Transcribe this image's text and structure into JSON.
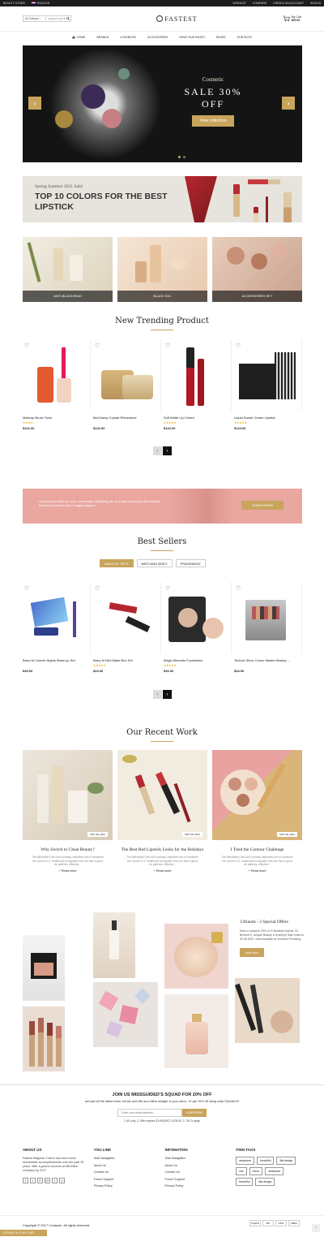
{
  "topbar": {
    "store": "BEAUTY STORE",
    "language": "ENGLISH",
    "wishlist": "WISHLIST",
    "compare": "COMPARE",
    "account": "CREATE AN ACCOUNT",
    "signin": "SIGN IN"
  },
  "header": {
    "category": "All Categor...",
    "search_placeholder": "SEARCH ENTIRE STO",
    "logo": "FASTEST",
    "cart_title": "My Cart",
    "cart_total": "$00.00",
    "cart_count": "0"
  },
  "nav": [
    "HOME",
    "BRANDS",
    "LOOKBOOK",
    "ACCESSORIES",
    "DEMO SUB PAGES",
    "PAGES",
    "OUR BLOG"
  ],
  "hero": {
    "subtitle": "Cosmetic",
    "title": "SALE 30% OFF",
    "cta": "View collection"
  },
  "lip_banner": {
    "line1": "Spring Summer 2021 Sale!",
    "line2": "TOP 10 COLORS FOR THE BEST LIPSTICK"
  },
  "categories": [
    "ANTI-BLACKHEAD",
    "BLACK SOL",
    "ACCESSORIES SET"
  ],
  "trending": {
    "title": "New Trending Product",
    "products": [
      {
        "name": "Makeup Brush Tools",
        "price": "$121.00",
        "stars": "★★★★☆"
      },
      {
        "name": "BioChamp Crystal Rhinestone",
        "price": "$122.00",
        "stars": ""
      },
      {
        "name": "Soft Matte Lip Cream",
        "price": "$122.00",
        "stars": "★★★★★"
      },
      {
        "name": "Liquid Suede Cream Lipstick",
        "price": "$124.00",
        "stars": "★★★★★"
      }
    ]
  },
  "promo": {
    "text": "Lorem ipsum dolor sit amet, consectetur adipiscing elit, sed diam nonummy nibh euismod tincidunt ut laoreet dolore magna aliquam",
    "cta": "LEARN MORE"
  },
  "bestsellers": {
    "title": "Best Sellers",
    "tabs": [
      "MAKE UP SETS",
      "BATH AND BODY",
      "FRAGRANCE"
    ],
    "products": [
      {
        "name": "Barry M Cosmic Nights Make-up Set",
        "price": "$45.00",
        "stars": ""
      },
      {
        "name": "Barry M Mini Matte Box Set",
        "price": "$23.00",
        "stars": "★★★★★"
      },
      {
        "name": "Magic Minerals Foundation",
        "price": "$26.00",
        "stars": "★★★★★"
      },
      {
        "name": "Technic Silver Colour Master Beauty ...",
        "price": "$34.00",
        "stars": ""
      }
    ]
  },
  "recent": {
    "title": "Our Recent Work",
    "posts": [
      {
        "title": "Why Switch to Clean Beauty?",
        "date": "MAY 08, 2021",
        "excerpt": "The Affordable Care Act's primary objectives are to transform the current U.S. healthcare ecosystem into one that is good for patients, effective...",
        "more": "+ Read more"
      },
      {
        "title": "The Best Red Lipstick Looks for the Holidays",
        "date": "MAY 08, 2021",
        "excerpt": "The Affordable Care Act's primary objectives are to transform the current U.S. healthcare ecosystem into one that is good for patients, effective...",
        "more": "+ Read more"
      },
      {
        "title": "I Tried the Contour Challenge",
        "date": "MAY 08, 2021",
        "excerpt": "The Affordable Care Act's primary objectives are to transform the current U.S. healthcare ecosystem into one that is good for patients, effective...",
        "more": "+ Read more"
      }
    ]
  },
  "brands": {
    "title": "3 Brands - 3 Special Offers",
    "text": "Save a massive 15% on 3 fantastic brands: Dr. Brenner's, Unique Beauty & Rosehip! Sale ends on 09.05.2021. Now available at Victorian Plumbing",
    "cta": "shop Now"
  },
  "newsletter": {
    "title": "JOIN US MISSGUIDED'S SQUAD FOR 20% OFF",
    "subtitle": "and get all the latest news, trends and offs and offers straight to your inbox. Or get 15% off using code SQUAD15",
    "placeholder": "Enter your email address...",
    "button": "SUBSCRIBE",
    "note": "1 UK only. 2. Offer expires 23:59(GMT) 12/03/16. 3. T&C's apply"
  },
  "footer": {
    "about_title": "ABOUT US",
    "about_text": "Fastest Magento 2 store has seen some remarkable accomplishments over the past 30 years. With a goal to become an $8 billion company by 2017.",
    "social": [
      "f",
      "t",
      "P",
      "G+",
      "t",
      "V"
    ],
    "col2_title": "YOU LINK",
    "col2_links": [
      "Side Navigation",
      "About Us",
      "Contact Us",
      "Forum Support",
      "Privacy Policy"
    ],
    "col3_title": "INFOMATION",
    "col3_links": [
      "Side Navigation",
      "About Us",
      "Contact Us",
      "Forum Support",
      "Privacy Policy"
    ],
    "tags_title": "ITEM TAGS",
    "tags": [
      "awesome",
      "beautiful",
      "flat design",
      "css",
      "menu",
      "awesome",
      "beautiful",
      "flat design"
    ]
  },
  "bottom": {
    "copyright": "Copyright © 2017 Codazon. All rights reserved.",
    "payments": [
      "PayPal",
      "MC",
      "VISA",
      "AMEX"
    ],
    "cart_bar": "0 ITEM(S) IN YOUR CART",
    "to_top": "↑"
  },
  "colors": {
    "accent": "#c9a45c",
    "pink_banner": "#e9a7a0",
    "dark": "#1d1d1d"
  }
}
